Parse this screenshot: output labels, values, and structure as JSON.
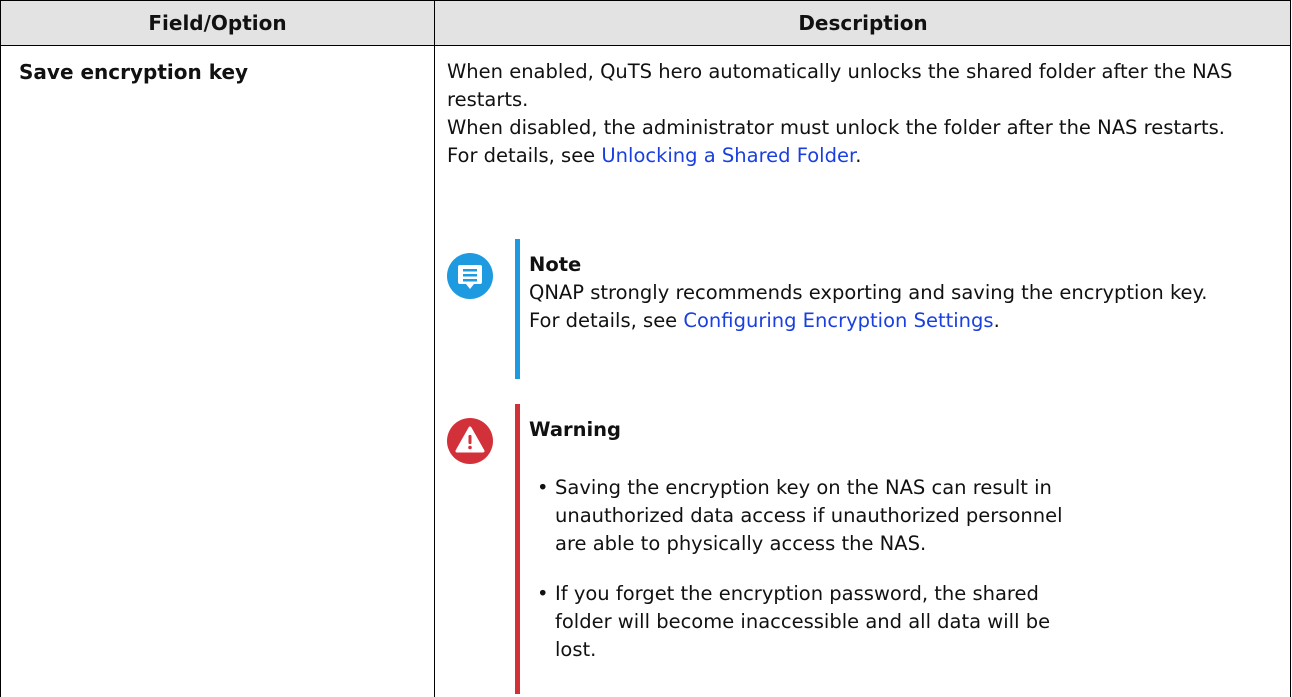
{
  "table": {
    "headers": {
      "col1": "Field/Option",
      "col2": "Description"
    },
    "row": {
      "field": "Save encryption key",
      "desc_line1": "When enabled, QuTS hero automatically unlocks the shared folder after the NAS restarts.",
      "desc_line2": "When disabled, the administrator must unlock the folder after the NAS restarts.",
      "desc_line3_prefix": "For details, see ",
      "desc_line3_link": "Unlocking a Shared Folder",
      "desc_line3_suffix": "."
    }
  },
  "note": {
    "title": "Note",
    "text": "QNAP strongly recommends exporting and saving the encryption key.",
    "details_prefix": "For details, see ",
    "details_link": "Configuring Encryption Settings",
    "details_suffix": ".",
    "icon": "note-icon",
    "color": "#1e9ae0"
  },
  "warning": {
    "title": "Warning",
    "icon": "warning-icon",
    "color": "#d3313a",
    "items": [
      "Saving the encryption key on the NAS can result in unauthorized data access if unauthorized personnel are able to physically access the NAS.",
      "If you forget the encryption password, the shared folder will become inaccessible and all data will be lost."
    ],
    "bullet": "•"
  },
  "colors": {
    "header_bg": "#e3e3e3",
    "link": "#1a3fe0"
  }
}
